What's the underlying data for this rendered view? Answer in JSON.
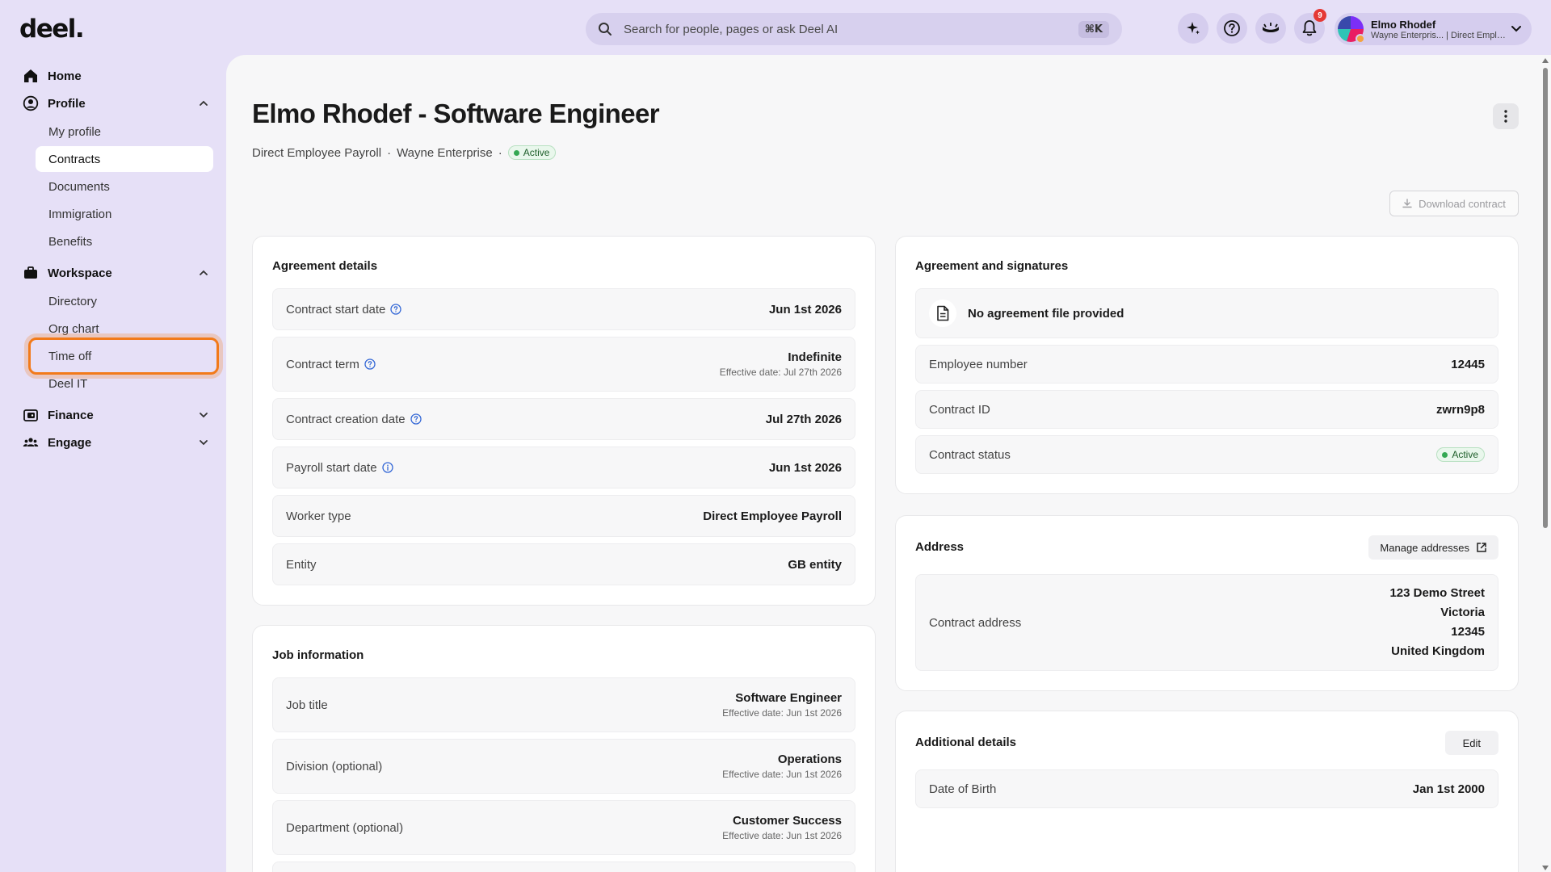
{
  "app": {
    "logo": "deel."
  },
  "search": {
    "placeholder": "Search for people, pages or ask Deel AI",
    "shortcut": "⌘K"
  },
  "top_icons": {
    "ai": "sparkle-icon",
    "help": "help-icon",
    "theme": "shield-eye-icon",
    "notifications": "bell-icon",
    "notification_count": "9"
  },
  "user": {
    "name": "Elmo Rhodef",
    "subtitle": "Wayne Enterpris... | Direct Employ..."
  },
  "sidebar": {
    "home": "Home",
    "profile": {
      "label": "Profile",
      "items": [
        "My profile",
        "Contracts",
        "Documents",
        "Immigration",
        "Benefits"
      ],
      "active": "Contracts"
    },
    "workspace": {
      "label": "Workspace",
      "items": [
        "Directory",
        "Org chart",
        "Time off",
        "Deel IT"
      ]
    },
    "finance": "Finance",
    "engage": "Engage"
  },
  "page": {
    "title": "Elmo Rhodef - Software Engineer",
    "subtitle_parts": [
      "Direct Employee Payroll",
      "Wayne Enterprise"
    ],
    "separator": "·",
    "status": "Active",
    "download": "Download contract"
  },
  "agreement_details": {
    "title": "Agreement details",
    "rows": [
      {
        "label": "Contract start date",
        "value": "Jun 1st 2026",
        "note": ""
      },
      {
        "label": "Contract term",
        "value": "Indefinite",
        "note": "Effective date: Jul 27th 2026"
      },
      {
        "label": "Contract creation date",
        "value": "Jul 27th 2026",
        "note": ""
      },
      {
        "label": "Payroll start date",
        "value": "Jun 1st 2026",
        "note": ""
      },
      {
        "label": "Worker type",
        "value": "Direct Employee Payroll",
        "note": ""
      },
      {
        "label": "Entity",
        "value": "GB entity",
        "note": ""
      }
    ]
  },
  "job_information": {
    "title": "Job information",
    "rows": [
      {
        "label": "Job title",
        "value": "Software Engineer",
        "note": "Effective date: Jun 1st 2026"
      },
      {
        "label": "Division (optional)",
        "value": "Operations",
        "note": "Effective date: Jun 1st 2026"
      },
      {
        "label": "Department (optional)",
        "value": "Customer Success",
        "note": "Effective date: Jun 1st 2026"
      }
    ]
  },
  "agreement_signatures": {
    "title": "Agreement and signatures",
    "file_text": "No agreement file provided",
    "rows": [
      {
        "label": "Employee number",
        "value": "12445"
      },
      {
        "label": "Contract ID",
        "value": "zwrn9p8"
      },
      {
        "label": "Contract status",
        "value": "Active"
      }
    ]
  },
  "address": {
    "title": "Address",
    "manage": "Manage addresses",
    "label": "Contract address",
    "lines": [
      "123 Demo Street",
      "Victoria",
      "12345",
      "United Kingdom"
    ]
  },
  "additional_details": {
    "title": "Additional details",
    "edit": "Edit",
    "rows": [
      {
        "label": "Date of Birth",
        "value": "Jan 1st 2000"
      }
    ]
  },
  "colors": {
    "accent_focus": "#f27a1a",
    "status_green": "#33a852",
    "background": "#e6e0f7"
  }
}
